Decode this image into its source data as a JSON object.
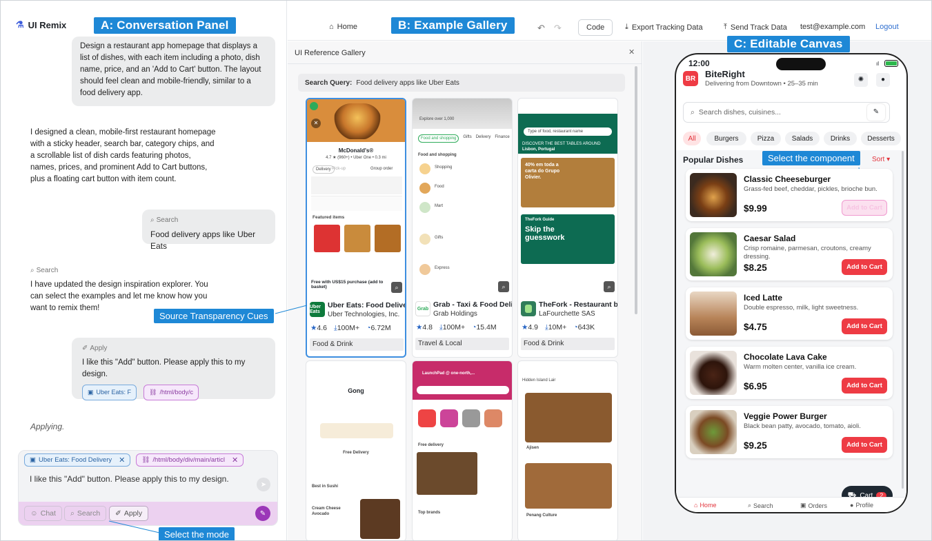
{
  "app": {
    "brand": "UI Remix",
    "user_email": "test@example.com",
    "logout": "Logout"
  },
  "callouts": {
    "conversation": "A: Conversation Panel",
    "gallery": "B: Example Gallery",
    "canvas": "C: Editable Canvas",
    "transparency": "Source Transparency Cues",
    "mode": "Select the mode",
    "component": "Select the component"
  },
  "toolbar": {
    "home": "Home",
    "code": "Code",
    "export": "Export Tracking Data",
    "send": "Send Track Data"
  },
  "conversation": {
    "user_msg_1": "Design a restaurant app homepage that displays a list of dishes, with each item including a photo, dish name, price, and an 'Add to Cart' button. The layout should feel clean and mobile-friendly, similar to a food delivery app.",
    "assistant_msg_1": "I designed a clean, mobile-first restaurant homepage with a sticky header, search bar, category chips, and a scrollable list of dish cards featuring photos, names, prices, and prominent Add to Cart buttons, plus a floating cart button with item count.",
    "search_tag": "Search",
    "user_msg_2": "Food delivery apps like Uber Eats",
    "assistant_search_tag": "Search",
    "assistant_msg_2": "I have updated the design inspiration explorer. You can select the examples and let me know how you want to remix them!",
    "apply_tag": "Apply",
    "user_msg_3": "I like this \"Add\" button. Please apply this to my design.",
    "ref_chip_1": "Uber Eats: F",
    "ref_chip_2": "/html/body/c",
    "status": "Applying."
  },
  "composer": {
    "chip_1": "Uber Eats: Food Delivery",
    "chip_2": "/html/body/div/main/articl",
    "text": "I like this \"Add\" button. Please apply this to my design.",
    "modes": [
      "Chat",
      "Search",
      "Apply"
    ],
    "active_mode": "Apply"
  },
  "gallery": {
    "title": "UI Reference Gallery",
    "search_label": "Search Query:",
    "search_value": "Food delivery apps like Uber Eats",
    "apps": [
      {
        "name": "Uber Eats: Food Delivery",
        "developer": "Uber Technologies, Inc.",
        "rating": "4.6",
        "downloads": "100M+",
        "reviews": "6.72M",
        "category": "Food & Drink",
        "icon_text": "Uber Eats",
        "icon_color": "#0d7a3c"
      },
      {
        "name": "Grab - Taxi & Food Delivery",
        "developer": "Grab Holdings",
        "rating": "4.8",
        "downloads": "100M+",
        "reviews": "15.4M",
        "category": "Travel & Local",
        "icon_text": "Grab",
        "icon_color": "#ffffff"
      },
      {
        "name": "TheFork - Restaurant booking",
        "developer": "LaFourchette SAS",
        "rating": "4.9",
        "downloads": "10M+",
        "reviews": "643K",
        "category": "Food & Drink",
        "icon_text": "",
        "icon_color": "#2f7d5a"
      }
    ],
    "shot_texts": {
      "mcd_title": "McDonald's®",
      "mcd_meta": "4.7 ★ (960+) • Uber One • 0.3 mi",
      "delivery": "Delivery",
      "pickup": "Pick-up",
      "group_order": "Group order",
      "featured": "Featured items",
      "free_with": "Free with US$15 purchase (add to basket)",
      "grab_hdr": "Explore over 1,000",
      "grab_sections": [
        "Food and shopping",
        "Gifts",
        "Delivery",
        "Finance"
      ],
      "grab_items": [
        "Shopping",
        "Food",
        "Mart",
        "Gifts",
        "Express"
      ],
      "fork_search": "Type of food, restaurant name",
      "fork_discover": "DISCOVER THE BEST TABLES AROUND",
      "fork_city": "Lisbon, Portugal",
      "fork_promo": "40% em toda a carta do Grupo Olivier.",
      "fork_guide": "TheFork Guide",
      "fork_skip": "Skip the guesswork",
      "gong_title": "Gong",
      "gong_free": "Free Delivery",
      "gong_best": "Best in Sushi",
      "gong_item": "Cream Cheese Avocado",
      "lp_title": "LaunchPad @ one-north,...",
      "lp_free": "Free delivery",
      "lp_brands": "Top brands",
      "hid_title": "Hidden Island Lair",
      "hid_r1": "Ajisen",
      "hid_r2": "Penang Culture"
    }
  },
  "phone": {
    "time": "12:00",
    "logo": "BR",
    "name": "BiteRight",
    "subtitle": "Delivering from Downtown • 25–35 min",
    "search_placeholder": "Search dishes, cuisines...",
    "categories": [
      "All",
      "Burgers",
      "Pizza",
      "Salads",
      "Drinks",
      "Desserts"
    ],
    "section_title": "Popular Dishes",
    "sort": "Sort ▾",
    "dishes": [
      {
        "name": "Classic Cheeseburger",
        "desc": "Grass-fed beef, cheddar, pickles, brioche bun.",
        "price": "$9.99",
        "btn": "Add to Cart"
      },
      {
        "name": "Caesar Salad",
        "desc": "Crisp romaine, parmesan, croutons, creamy dressing.",
        "price": "$8.25",
        "btn": "Add to Cart"
      },
      {
        "name": "Iced Latte",
        "desc": "Double espresso, milk, light sweetness.",
        "price": "$4.75",
        "btn": "Add to Cart"
      },
      {
        "name": "Chocolate Lava Cake",
        "desc": "Warm molten center, vanilla ice cream.",
        "price": "$6.95",
        "btn": "Add to Cart"
      },
      {
        "name": "Veggie Power Burger",
        "desc": "Black bean patty, avocado, tomato, aioli.",
        "price": "$9.25",
        "btn": "Add to Cart"
      }
    ],
    "cart_label": "Cart",
    "cart_count": "2",
    "nav": [
      "Home",
      "Search",
      "Orders",
      "Profile"
    ]
  },
  "colors": {
    "accent": "#1e88d6",
    "brand_red": "#ee3b44",
    "apply_mode": "#ecd1f0"
  }
}
